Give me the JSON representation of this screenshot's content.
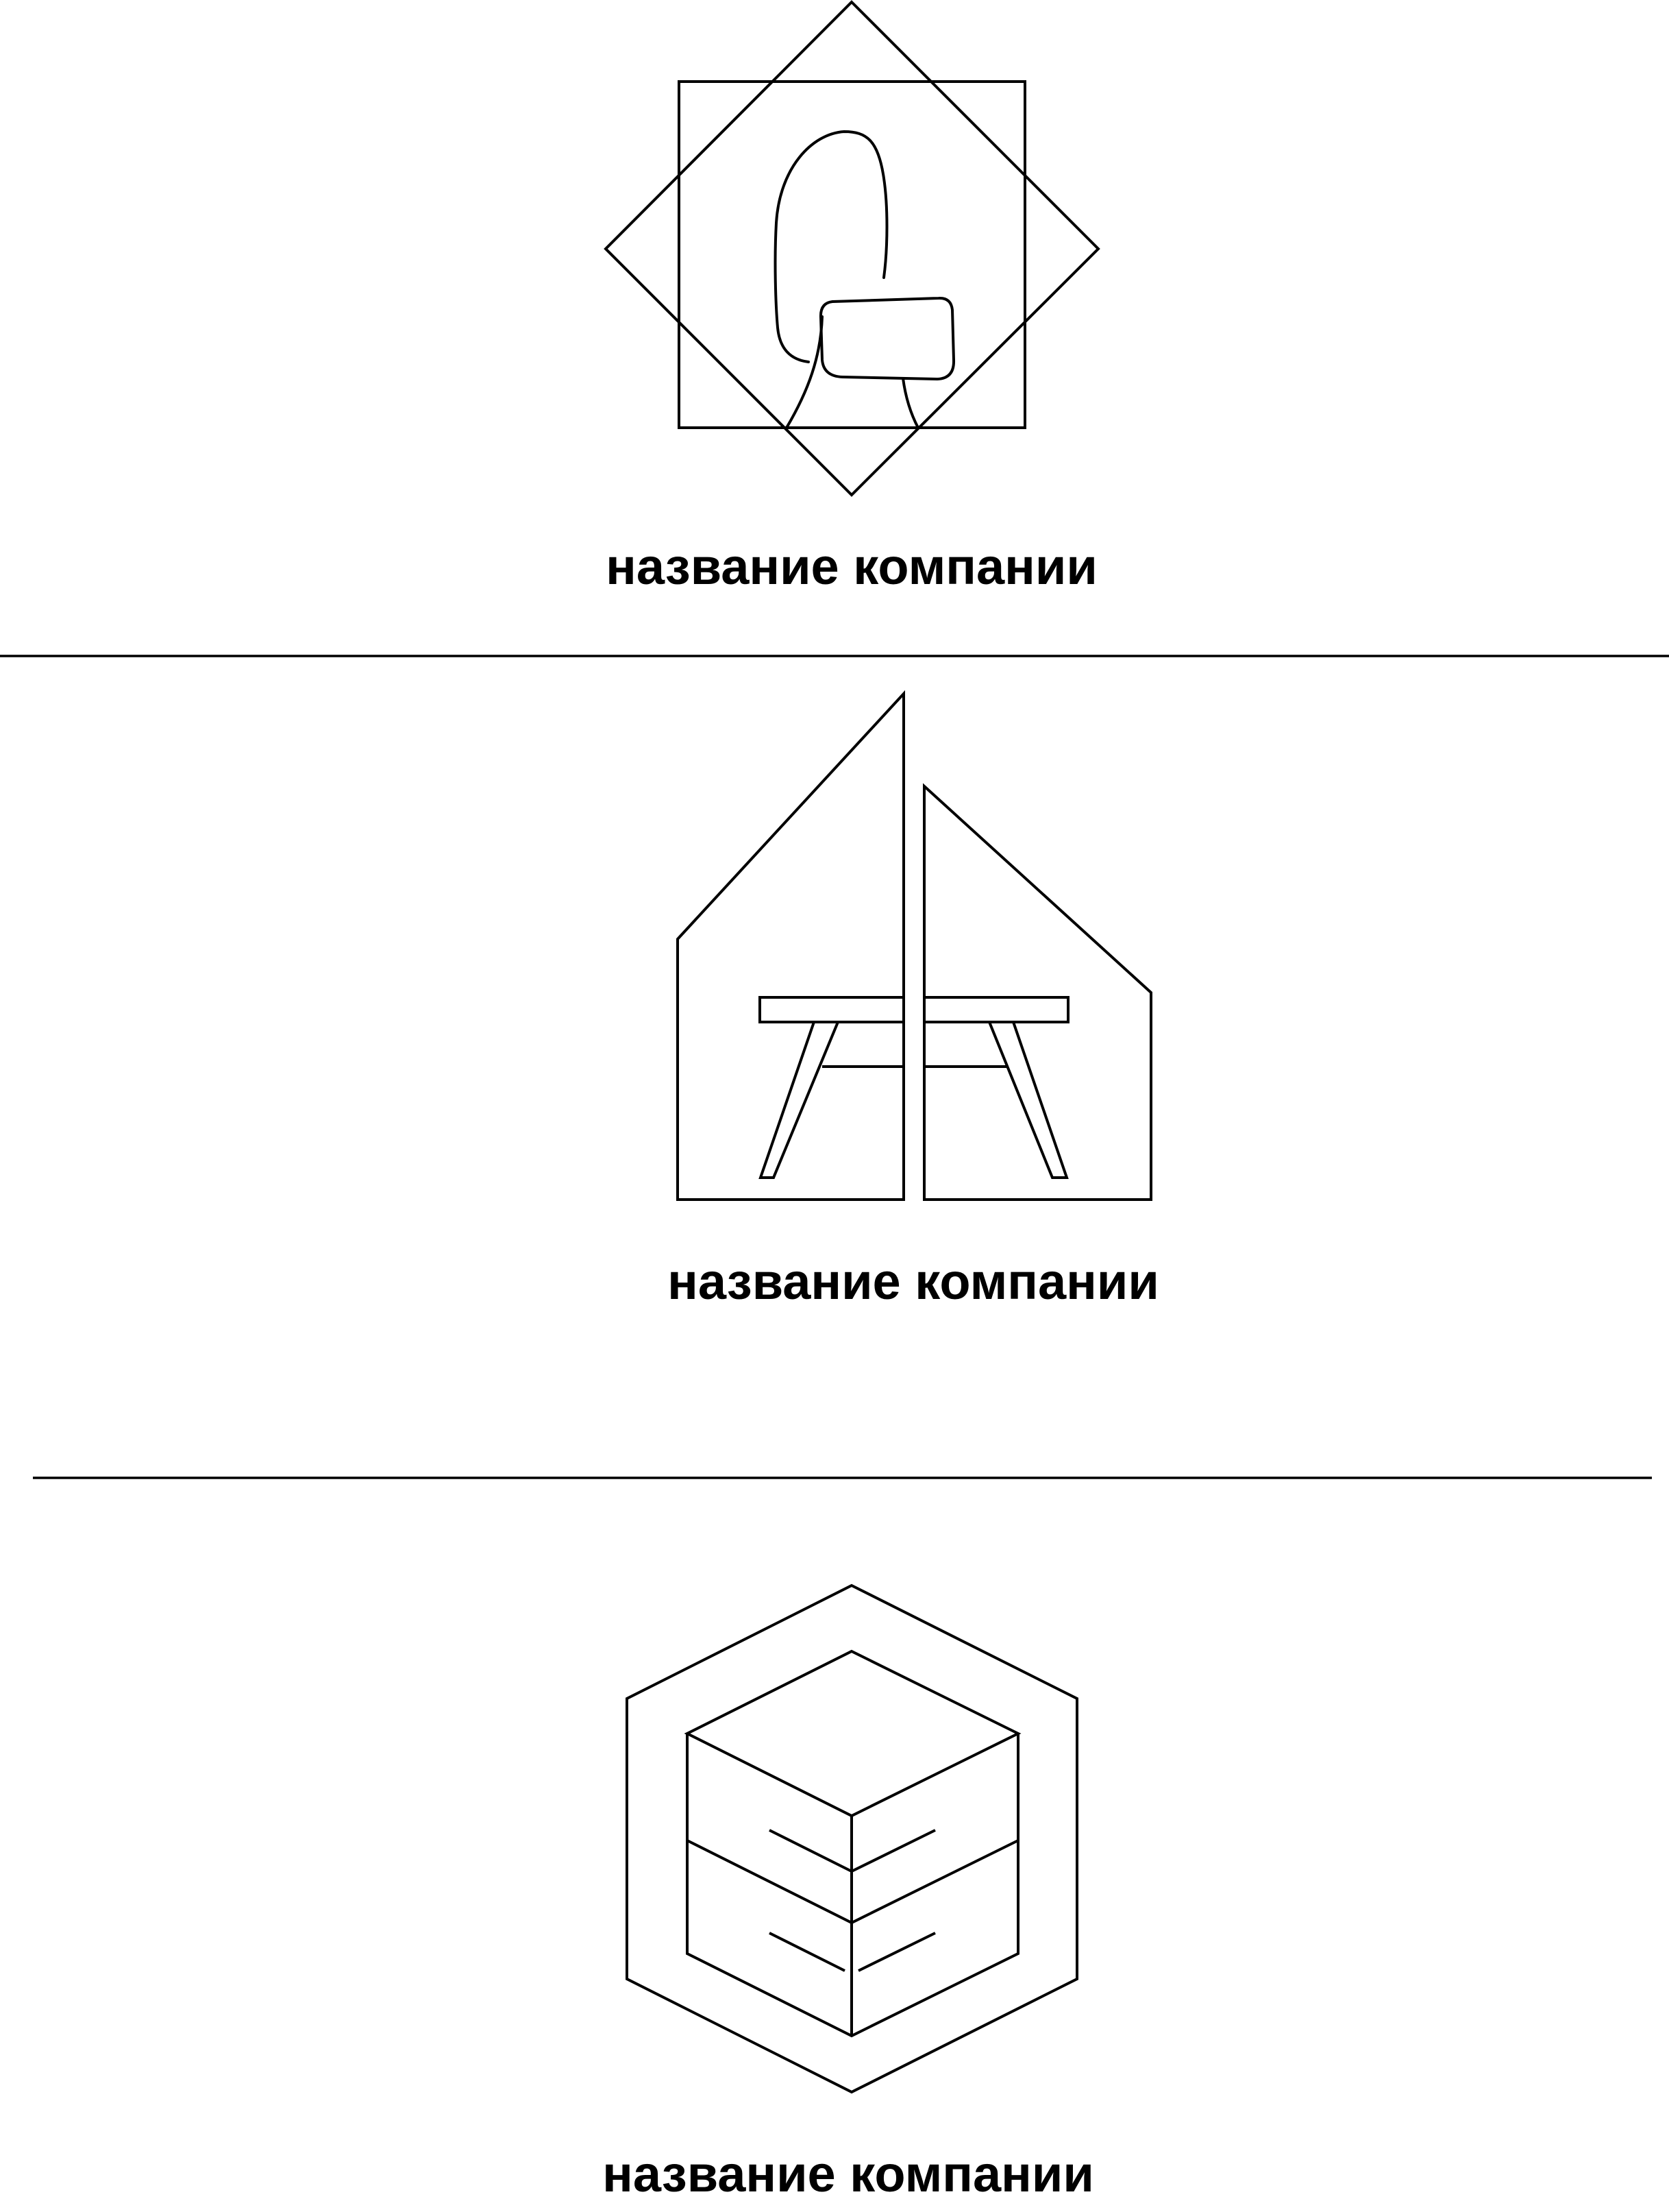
{
  "logos": [
    {
      "caption": "название компании",
      "icon": "chair-in-square-star-icon"
    },
    {
      "caption": "название компании",
      "icon": "table-in-split-house-icon"
    },
    {
      "caption": "название компании",
      "icon": "drawer-cube-in-hexagon-icon"
    }
  ]
}
